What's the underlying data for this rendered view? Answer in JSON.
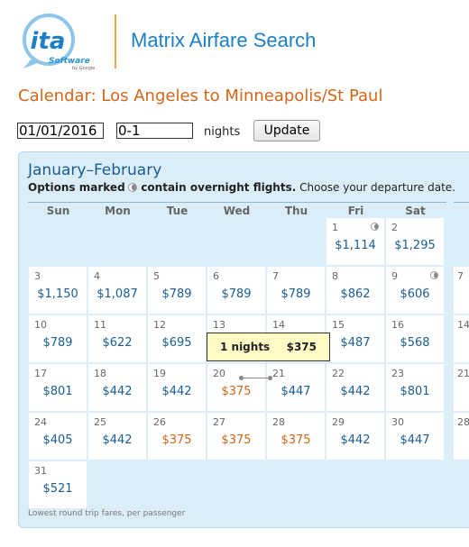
{
  "header": {
    "logo_text": "ita",
    "logo_sub": "Software",
    "logo_by": "by Google",
    "app_title": "Matrix Airfare Search"
  },
  "page_title": "Calendar: Los Angeles to Minneapolis/St Paul",
  "form": {
    "date_value": "01/01/2016",
    "nights_value": "0-1",
    "nights_label": "nights",
    "update_label": "Update"
  },
  "calendar": {
    "month_title": "January–February",
    "notice_bold": "Options marked",
    "notice_bold2": "contain overnight flights.",
    "notice_rest": "Choose your departure date.",
    "weekdays": [
      "Sun",
      "Mon",
      "Tue",
      "Wed",
      "Thu",
      "Fri",
      "Sat"
    ],
    "days": [
      {
        "day": "1",
        "price": "$1,114",
        "cheap": false,
        "overnight": true
      },
      {
        "day": "2",
        "price": "$1,295",
        "cheap": false,
        "overnight": false
      },
      {
        "day": "3",
        "price": "$1,150",
        "cheap": false,
        "overnight": false
      },
      {
        "day": "4",
        "price": "$1,087",
        "cheap": false,
        "overnight": false
      },
      {
        "day": "5",
        "price": "$789",
        "cheap": false,
        "overnight": false
      },
      {
        "day": "6",
        "price": "$789",
        "cheap": false,
        "overnight": false
      },
      {
        "day": "7",
        "price": "$789",
        "cheap": false,
        "overnight": false
      },
      {
        "day": "8",
        "price": "$862",
        "cheap": false,
        "overnight": false
      },
      {
        "day": "9",
        "price": "$606",
        "cheap": false,
        "overnight": true
      },
      {
        "day": "10",
        "price": "$789",
        "cheap": false,
        "overnight": false
      },
      {
        "day": "11",
        "price": "$622",
        "cheap": false,
        "overnight": false
      },
      {
        "day": "12",
        "price": "$695",
        "cheap": false,
        "overnight": false
      },
      {
        "day": "13",
        "price": "",
        "cheap": false,
        "overnight": false
      },
      {
        "day": "14",
        "price": "",
        "cheap": false,
        "overnight": false
      },
      {
        "day": "15",
        "price": "$487",
        "cheap": false,
        "overnight": false
      },
      {
        "day": "16",
        "price": "$568",
        "cheap": false,
        "overnight": false
      },
      {
        "day": "17",
        "price": "$801",
        "cheap": false,
        "overnight": false
      },
      {
        "day": "18",
        "price": "$442",
        "cheap": false,
        "overnight": false
      },
      {
        "day": "19",
        "price": "$442",
        "cheap": false,
        "overnight": false
      },
      {
        "day": "20",
        "price": "$375",
        "cheap": true,
        "overnight": false
      },
      {
        "day": "21",
        "price": "$447",
        "cheap": false,
        "overnight": false
      },
      {
        "day": "22",
        "price": "$442",
        "cheap": false,
        "overnight": false
      },
      {
        "day": "23",
        "price": "$801",
        "cheap": false,
        "overnight": false
      },
      {
        "day": "24",
        "price": "$405",
        "cheap": false,
        "overnight": false
      },
      {
        "day": "25",
        "price": "$442",
        "cheap": false,
        "overnight": false
      },
      {
        "day": "26",
        "price": "$375",
        "cheap": true,
        "overnight": false
      },
      {
        "day": "27",
        "price": "$375",
        "cheap": true,
        "overnight": false
      },
      {
        "day": "28",
        "price": "$375",
        "cheap": true,
        "overnight": false
      },
      {
        "day": "29",
        "price": "$442",
        "cheap": false,
        "overnight": false
      },
      {
        "day": "30",
        "price": "$447",
        "cheap": false,
        "overnight": false
      },
      {
        "day": "31",
        "price": "$521",
        "cheap": false,
        "overnight": false
      }
    ],
    "next_month_days": [
      "7",
      "14",
      "21",
      "28"
    ],
    "tooltip": {
      "nights": "1 nights",
      "price": "$375"
    },
    "footer_note": "Lowest round trip fares, per passenger"
  },
  "colors": {
    "brand_blue": "#1f7fc6",
    "title_orange": "#d2661a",
    "panel_bg": "#dbeef8",
    "price_blue": "#1a5d93",
    "cheap_orange": "#d2661a",
    "tooltip_bg": "#fffbc6"
  }
}
